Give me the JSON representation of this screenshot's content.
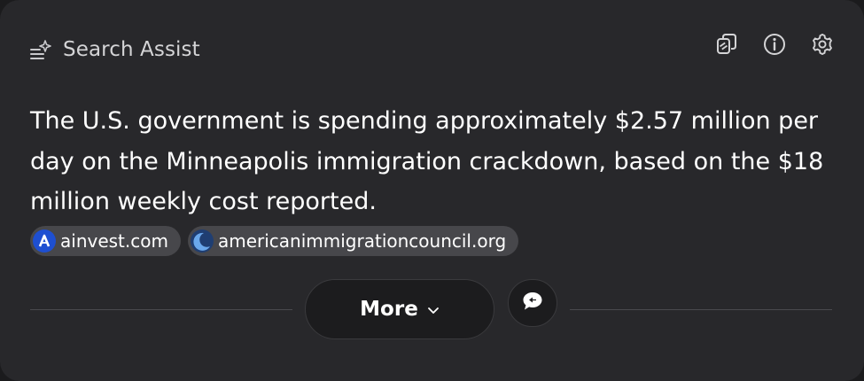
{
  "header": {
    "title": "Search Assist",
    "title_icon": "sparkle-list-icon",
    "actions": [
      {
        "name": "copy-icon"
      },
      {
        "name": "info-icon"
      },
      {
        "name": "settings-icon"
      }
    ]
  },
  "answer": {
    "text": "The U.S. government is spending approximately $2.57 million per day on the Minneapolis immigration crackdown, based on the $18 million weekly cost reported."
  },
  "sources": [
    {
      "label": "ainvest.com",
      "favicon_color": "#1e4fd1"
    },
    {
      "label": "americanimmigrationcouncil.org",
      "favicon_color": "#4a86d8"
    }
  ],
  "footer": {
    "more_label": "More",
    "more_icon": "chevron-down-icon",
    "feedback_icon": "feedback-chat-icon"
  },
  "colors": {
    "background": "#1b1b1d",
    "panel": "#28282b",
    "chip": "#47474b",
    "button": "#1c1c1e"
  }
}
